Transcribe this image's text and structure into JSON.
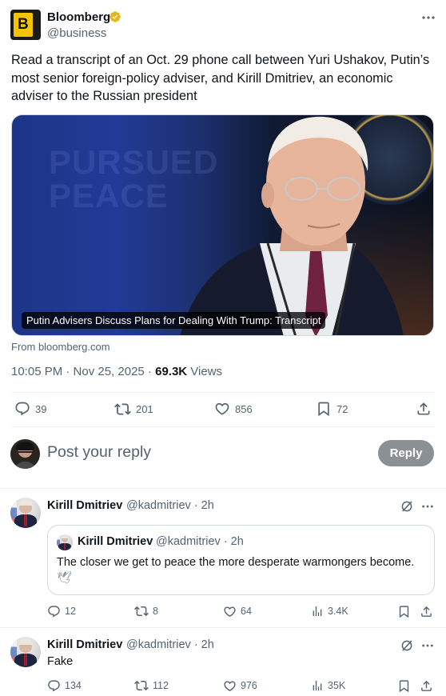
{
  "tweet": {
    "author_name": "Bloomberg",
    "author_handle": "@business",
    "avatar_letter": "B",
    "text": "Read a transcript of an Oct. 29 phone call between Yuri Ushakov, Putin’s most senior foreign-policy adviser, and Kirill Dmitriev, an economic adviser to the Russian president",
    "media": {
      "watermark_line1": "PURSUED",
      "watermark_line2": "PEACE",
      "caption": "Putin Advisers Discuss Plans for Dealing With Trump: Transcript"
    },
    "source": "From bloomberg.com",
    "timestamp": "10:05 PM · Nov 25, 2025 · ",
    "views_count": "69.3K",
    "views_label": " Views",
    "stats": {
      "replies": "39",
      "reposts": "201",
      "likes": "856",
      "bookmarks": "72"
    }
  },
  "composer": {
    "placeholder": "Post your reply",
    "button_label": "Reply"
  },
  "replies": [
    {
      "author_name": "Kirill Dmitriev",
      "author_handle": "@kadmitriev · 2h",
      "quoted": {
        "author_name": "Kirill Dmitriev",
        "author_handle": "@kadmitriev · 2h",
        "text": "The closer we get to peace the more desperate warmongers become.",
        "emoji": "🕊"
      },
      "stats": {
        "replies": "12",
        "reposts": "8",
        "likes": "64",
        "views": "3.4K"
      }
    },
    {
      "author_name": "Kirill Dmitriev",
      "author_handle": "@kadmitriev · 2h",
      "text": "Fake",
      "stats": {
        "replies": "134",
        "reposts": "112",
        "likes": "976",
        "views": "35K"
      }
    }
  ],
  "colors": {
    "text": "#0f1419",
    "secondary": "#536471",
    "border": "#eff3f4",
    "verified": "#e2b719",
    "reply_button": "#8b9094"
  },
  "icons": [
    "more-icon",
    "verified-badge-icon",
    "reply-icon",
    "repost-icon",
    "like-icon",
    "bookmark-icon",
    "share-icon",
    "views-icon",
    "grok-icon"
  ]
}
